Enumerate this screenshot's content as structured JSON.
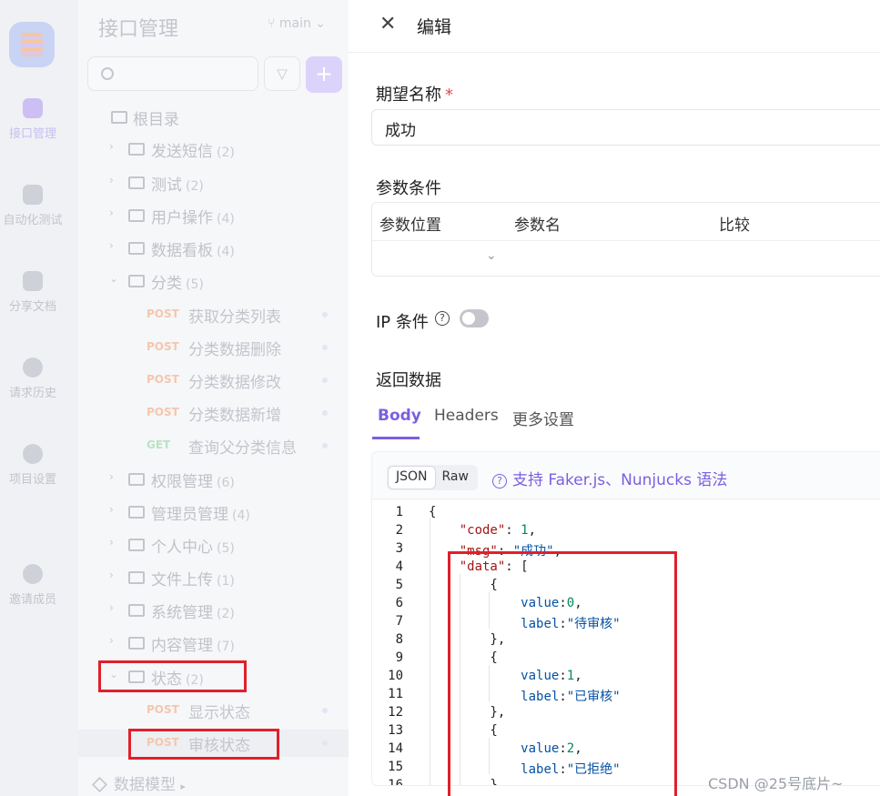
{
  "rail": {
    "items": [
      {
        "label": "接口管理"
      },
      {
        "label": "自动化测试"
      },
      {
        "label": "分享文档"
      },
      {
        "label": "请求历史"
      },
      {
        "label": "项目设置"
      },
      {
        "label": "邀请成员"
      }
    ]
  },
  "tree": {
    "title": "接口管理",
    "branch": "main",
    "search_placeholder": "",
    "add_label": "+",
    "root": "根目录",
    "folders": [
      {
        "name": "发送短信",
        "count": "(2)"
      },
      {
        "name": "测试",
        "count": "(2)"
      },
      {
        "name": "用户操作",
        "count": "(4)"
      },
      {
        "name": "数据看板",
        "count": "(4)"
      },
      {
        "name": "分类",
        "count": "(5)"
      },
      {
        "name": "权限管理",
        "count": "(6)"
      },
      {
        "name": "管理员管理",
        "count": "(4)"
      },
      {
        "name": "个人中心",
        "count": "(5)"
      },
      {
        "name": "文件上传",
        "count": "(1)"
      },
      {
        "name": "系统管理",
        "count": "(2)"
      },
      {
        "name": "内容管理",
        "count": "(7)"
      },
      {
        "name": "状态",
        "count": "(2)"
      }
    ],
    "category_apis": [
      {
        "method": "POST",
        "name": "获取分类列表"
      },
      {
        "method": "POST",
        "name": "分类数据删除"
      },
      {
        "method": "POST",
        "name": "分类数据修改"
      },
      {
        "method": "POST",
        "name": "分类数据新增"
      },
      {
        "method": "GET",
        "name": "查询父分类信息"
      }
    ],
    "status_apis": [
      {
        "method": "POST",
        "name": "显示状态"
      },
      {
        "method": "POST",
        "name": "审核状态"
      }
    ],
    "models": "数据模型",
    "models_arrow": "▸"
  },
  "editor": {
    "close": "✕",
    "title": "编辑",
    "name_label": "期望名称",
    "required_mark": "*",
    "name_value": "成功",
    "params_label": "参数条件",
    "params_cols": [
      "参数位置",
      "参数名",
      "比较"
    ],
    "ip_label": "IP 条件",
    "help": "?",
    "return_label": "返回数据",
    "tabs": [
      "Body",
      "Headers",
      "更多设置"
    ],
    "format_options": [
      "JSON",
      "Raw"
    ],
    "hint": "支持 Faker.js、Nunjucks 语法"
  },
  "code_lines": [
    "{",
    "    \"code\": 1,",
    "    \"msg\": \"成功\",",
    "    \"data\": [",
    "        {",
    "            value:0,",
    "            label:\"待审核\"",
    "        },",
    "        {",
    "            value:1,",
    "            label:\"已审核\"",
    "        },",
    "        {",
    "            value:2,",
    "            label:\"已拒绝\"",
    "        }"
  ],
  "watermark": "CSDN @25号底片~",
  "colors": {
    "accent": "#7b5fe0",
    "highlight_box": "#e0202b"
  }
}
